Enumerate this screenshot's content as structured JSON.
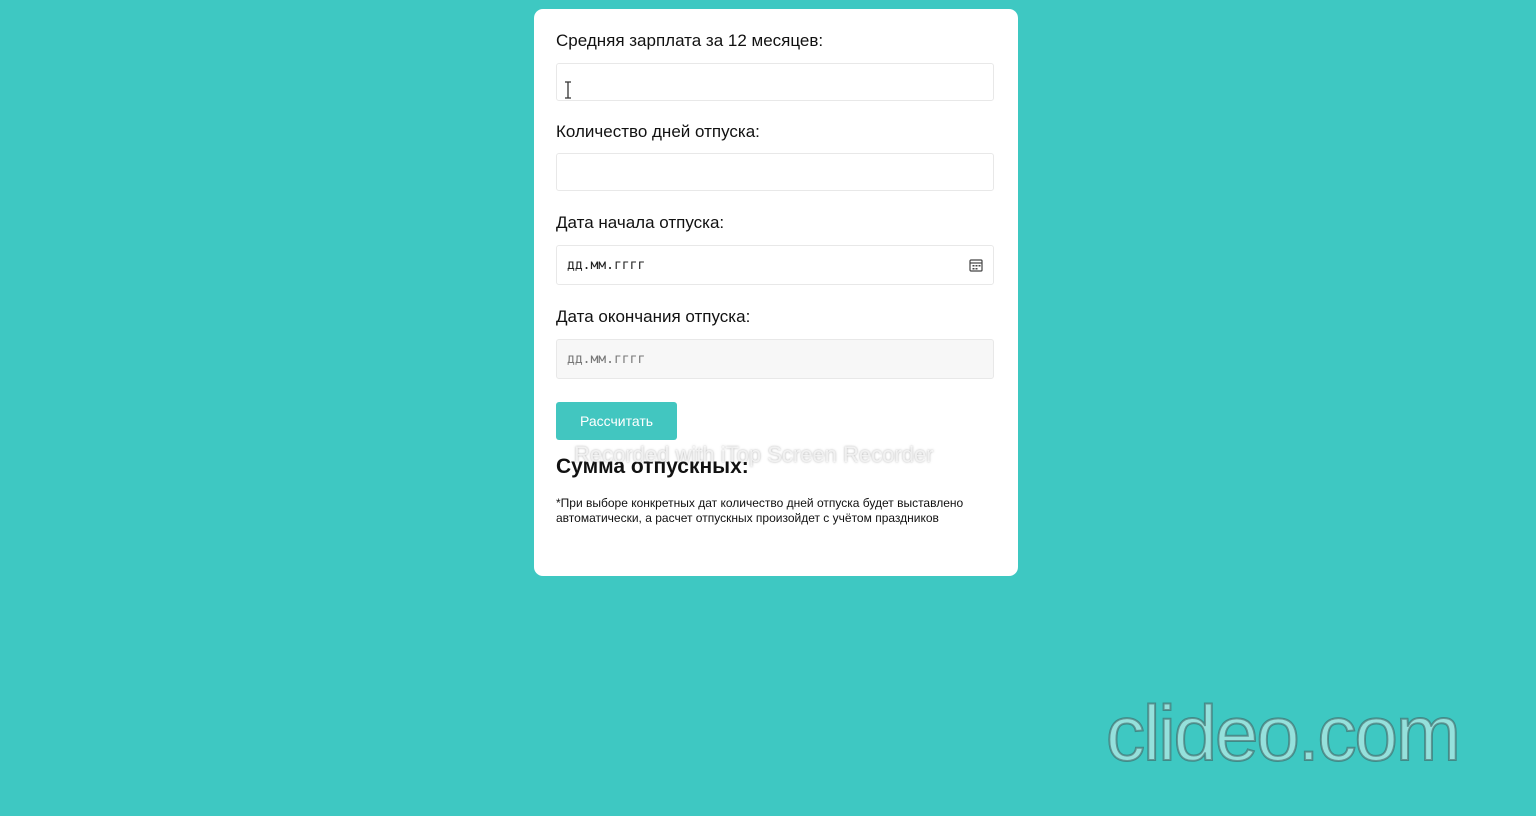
{
  "form": {
    "salary_label": "Средняя зарплата за 12 месяцев:",
    "salary_value": "",
    "days_label": "Количество дней отпуска:",
    "days_value": "",
    "start_date_label": "Дата начала отпуска:",
    "start_date_placeholder": "дд.мм.гггг",
    "end_date_label": "Дата окончания отпуска:",
    "end_date_placeholder": "дд.мм.гггг",
    "calculate_button": "Рассчитать"
  },
  "result": {
    "title": "Сумма отпускных:"
  },
  "footnote": "*При выборе конкретных дат количество дней отпуска будет выставлено автоматически, а расчет отпускных произойдет с учётом праздников",
  "watermarks": {
    "recorder": "Recorded with iTop Screen Recorder",
    "clideo": "clideo.com"
  },
  "colors": {
    "background": "#3ec8c2",
    "button": "#42c6c0",
    "card": "#ffffff"
  },
  "icons": {
    "date_picker": "calendar-icon",
    "cursor": "text-cursor-icon"
  }
}
